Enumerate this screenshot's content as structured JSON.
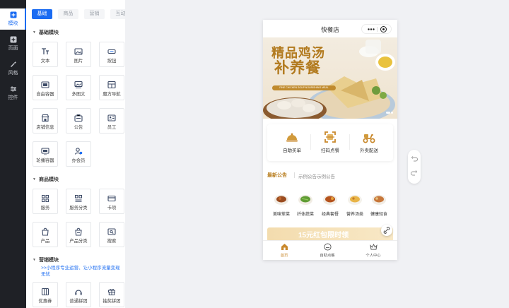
{
  "rail": {
    "items": [
      {
        "label": "模块",
        "icon": "plus-square-icon"
      },
      {
        "label": "页面",
        "icon": "plus-square-icon"
      },
      {
        "label": "风格",
        "icon": "magic-wand-icon"
      },
      {
        "label": "控件",
        "icon": "sliders-icon"
      }
    ],
    "active_index": 0
  },
  "panel": {
    "tabs": [
      "基础",
      "商品",
      "营销",
      "互动"
    ],
    "active_tab": 0,
    "sections": [
      {
        "title": "基础模块",
        "items": [
          {
            "label": "文本",
            "icon": "text-icon"
          },
          {
            "label": "图片",
            "icon": "image-icon"
          },
          {
            "label": "按钮",
            "icon": "button-icon"
          },
          {
            "label": "自由容器",
            "icon": "container-icon"
          },
          {
            "label": "多图文",
            "icon": "multi-image-icon"
          },
          {
            "label": "魔方导航",
            "icon": "grid-nav-icon"
          },
          {
            "label": "店铺信息",
            "icon": "store-icon"
          },
          {
            "label": "公告",
            "icon": "notice-icon"
          },
          {
            "label": "员工",
            "icon": "staff-card-icon"
          },
          {
            "label": "轮播容器",
            "icon": "carousel-icon"
          },
          {
            "label": "办会员",
            "icon": "member-icon"
          }
        ]
      },
      {
        "title": "商品模块",
        "items": [
          {
            "label": "服务",
            "icon": "service-grid-icon"
          },
          {
            "label": "服务分类",
            "icon": "service-category-icon"
          },
          {
            "label": "卡项",
            "icon": "card-icon"
          },
          {
            "label": "产品",
            "icon": "product-bag-icon"
          },
          {
            "label": "产品分类",
            "icon": "product-category-icon"
          },
          {
            "label": "搜索",
            "icon": "search-icon"
          }
        ]
      },
      {
        "title": "营销模块",
        "promo": ">>小程序专业运营、让小程序流量变现无忧",
        "items": [
          {
            "label": "优惠券",
            "icon": "coupon-icon"
          },
          {
            "label": "普通拼团",
            "icon": "group-buy-icon"
          },
          {
            "label": "抽奖拼团",
            "icon": "gift-icon"
          }
        ]
      }
    ]
  },
  "phone": {
    "title": "快餐店",
    "banner": {
      "title_line1": "精品鸡汤",
      "title_line2": "补养餐",
      "subtitle": "FINE CHICKEN SOUP NOURISHING MEAL"
    },
    "services": [
      {
        "label": "自助买单",
        "icon": "cloche-icon"
      },
      {
        "label": "扫码点餐",
        "icon": "scan-icon"
      },
      {
        "label": "外卖配送",
        "icon": "scooter-icon"
      }
    ],
    "notice": {
      "tag": "最新公告",
      "text": "示例公告示例公告"
    },
    "categories": [
      {
        "label": "美味荤菜",
        "icon": "meat-dish-icon"
      },
      {
        "label": "纤体蔬菜",
        "icon": "vegetable-dish-icon"
      },
      {
        "label": "经典套餐",
        "icon": "combo-meal-icon"
      },
      {
        "label": "营养汤类",
        "icon": "soup-icon"
      },
      {
        "label": "健康轻食",
        "icon": "light-meal-icon"
      }
    ],
    "promo_text": "15元红包限时领",
    "tabbar": [
      {
        "label": "首页",
        "icon": "home-icon",
        "active": true
      },
      {
        "label": "自助点餐",
        "icon": "dish-cover-icon",
        "active": false
      },
      {
        "label": "个人中心",
        "icon": "crown-icon",
        "active": false
      }
    ]
  },
  "history": {
    "undo_icon": "undo-icon",
    "redo_icon": "redo-icon"
  },
  "colors": {
    "primary": "#1b6cf2",
    "rail": "#1f2126",
    "gold": "#c9892d",
    "canvas": "#f0f1f4"
  }
}
